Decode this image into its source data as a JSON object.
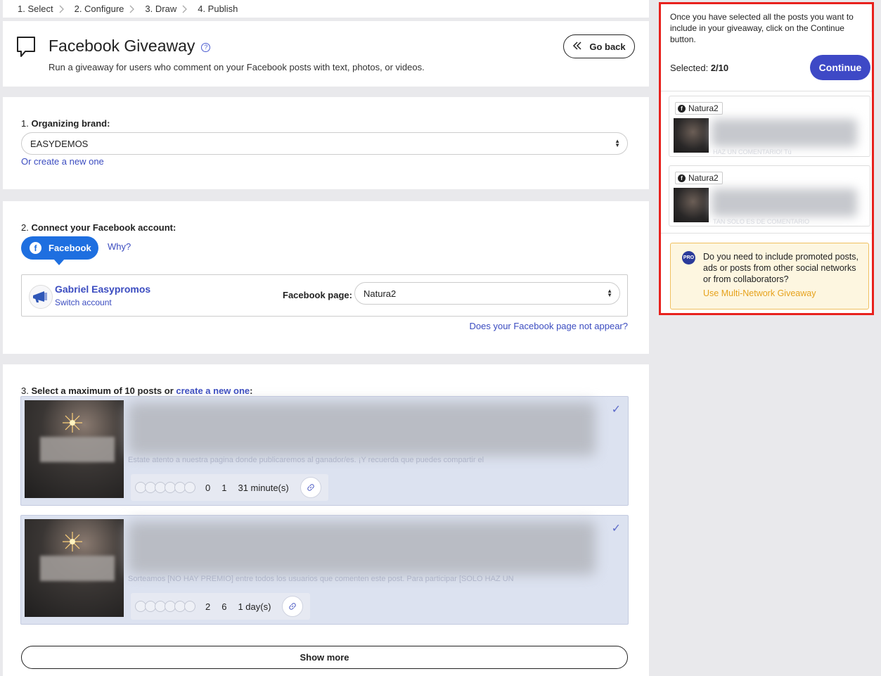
{
  "steps": [
    {
      "label": "1. Select"
    },
    {
      "label": "2. Configure"
    },
    {
      "label": "3. Draw"
    },
    {
      "label": "4. Publish"
    }
  ],
  "header": {
    "title": "Facebook Giveaway",
    "subtitle": "Run a giveaway for users who comment on your Facebook posts with text, photos, or videos.",
    "go_back_label": "Go back",
    "help_glyph": "?"
  },
  "brand": {
    "label_prefix": "1. ",
    "label_strong": "Organizing brand:",
    "selected_value": "EASYDEMOS",
    "create_link": "Or create a new one"
  },
  "connect": {
    "label_prefix": "2. ",
    "label_strong": "Connect your Facebook account:",
    "facebook_button": "Facebook",
    "why_link": "Why?",
    "account_name": "Gabriel Easypromos",
    "switch_account": "Switch account",
    "page_label": "Facebook page:",
    "page_value": "Natura2",
    "not_appear_link": "Does your Facebook page not appear?"
  },
  "posts": {
    "label_prefix": "3. ",
    "label_strong_a": "Select a maximum of 10 posts or ",
    "label_link": "create a new one",
    "label_strong_b": ":",
    "items": [
      {
        "faint_text": "Estate atento a nuestra pagina donde publicaremos al ganador/es. ¡Y recuerda que puedes compartir el",
        "comments": "0",
        "shares": "1",
        "age": "31 minute(s)",
        "check": "✓"
      },
      {
        "faint_text": "Sorteamos [NO HAY PREMIO] entre todos los usuarios que comenten este post. Para participar [SOLO HAZ UN",
        "comments": "2",
        "shares": "6",
        "age": "1 day(s)",
        "check": "✓"
      }
    ],
    "show_more": "Show more"
  },
  "sidebar": {
    "instructions": "Once you have selected all the posts you want to include in your giveaway, click on the Continue button.",
    "selected_label": "Selected: ",
    "selected_value": "2/10",
    "continue_label": "Continue",
    "selected_posts": [
      {
        "page": "Natura2",
        "faint_text": "HAZ UN COMENTARIO! Tú"
      },
      {
        "page": "Natura2",
        "faint_text": "TAN SOLO ES DE COMENTARIO"
      }
    ],
    "pro_badge": "PRO",
    "pro_text": "Do you need to include promoted posts, ads or posts from other social networks or from collaborators?",
    "pro_link": "Use Multi-Network Giveaway"
  },
  "colors": {
    "accent": "#3e49c6",
    "facebook_blue": "#1e6fe0",
    "highlight_border": "#e8211d",
    "pro_link": "#e6a21c"
  }
}
